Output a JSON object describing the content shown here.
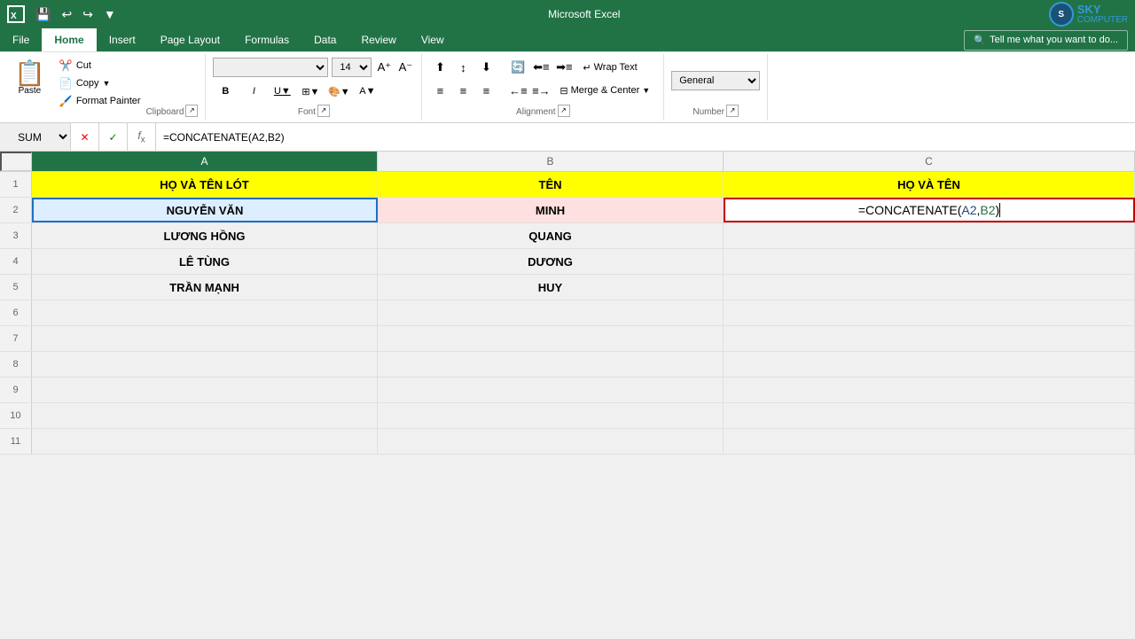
{
  "titlebar": {
    "title": "Microsoft Excel",
    "save_label": "💾",
    "undo_label": "↩",
    "redo_label": "↪",
    "dropdown_label": "▼"
  },
  "menutabs": {
    "tabs": [
      "File",
      "Home",
      "Insert",
      "Page Layout",
      "Formulas",
      "Data",
      "Review",
      "View"
    ],
    "active": "Home",
    "tell_me": "Tell me what you want to do..."
  },
  "ribbon": {
    "clipboard": {
      "label": "Clipboard",
      "paste_label": "Paste",
      "cut_label": "Cut",
      "copy_label": "Copy",
      "format_painter_label": "Format Painter"
    },
    "font": {
      "label": "Font",
      "font_name": "",
      "font_size": "14",
      "bold": "B",
      "italic": "I",
      "underline": "U",
      "increase_font": "A",
      "decrease_font": "A"
    },
    "alignment": {
      "label": "Alignment",
      "wrap_text": "Wrap Text",
      "merge_center": "Merge & Center"
    },
    "number": {
      "label": "Number",
      "format": "General"
    }
  },
  "formulabar": {
    "name_box": "SUM",
    "formula": "=CONCATENATE(A2,B2)"
  },
  "columns": {
    "headers": [
      "A",
      "B",
      "C"
    ]
  },
  "rows": [
    {
      "num": "1",
      "cells": [
        "HỌ VÀ TÊN LÓT",
        "TÊN",
        "HỌ VÀ TÊN"
      ],
      "style": "header"
    },
    {
      "num": "2",
      "cells": [
        "NGUYỄN VĂN",
        "MINH",
        "=CONCATENATE(A2,B2)"
      ],
      "style": "data-selected"
    },
    {
      "num": "3",
      "cells": [
        "LƯƠNG HỒNG",
        "QUANG",
        ""
      ],
      "style": "data"
    },
    {
      "num": "4",
      "cells": [
        "LÊ TÙNG",
        "DƯƠNG",
        ""
      ],
      "style": "data"
    },
    {
      "num": "5",
      "cells": [
        "TRẦN MẠNH",
        "HUY",
        ""
      ],
      "style": "data"
    },
    {
      "num": "6",
      "cells": [
        "",
        "",
        ""
      ],
      "style": "empty"
    },
    {
      "num": "7",
      "cells": [
        "",
        "",
        ""
      ],
      "style": "empty"
    },
    {
      "num": "8",
      "cells": [
        "",
        "",
        ""
      ],
      "style": "empty"
    },
    {
      "num": "9",
      "cells": [
        "",
        "",
        ""
      ],
      "style": "empty"
    },
    {
      "num": "10",
      "cells": [
        "",
        "",
        ""
      ],
      "style": "empty"
    },
    {
      "num": "11",
      "cells": [
        "",
        "",
        ""
      ],
      "style": "empty"
    }
  ],
  "skylogo": {
    "icon": "S",
    "line1": "SKY",
    "line2": "COMPUTER"
  }
}
